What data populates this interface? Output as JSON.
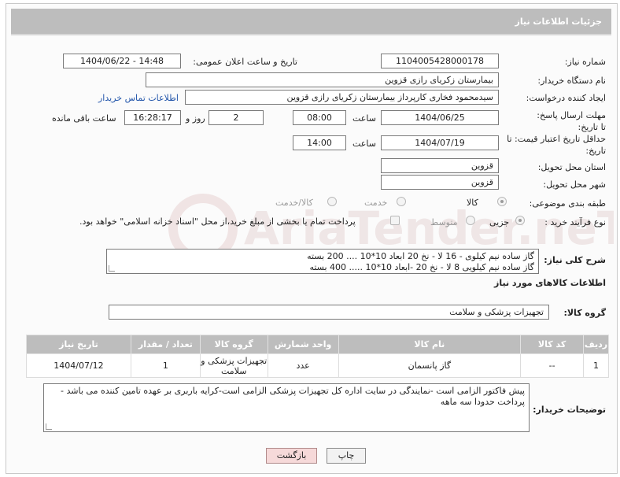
{
  "header": {
    "title": "جزئیات اطلاعات نیاز"
  },
  "labels": {
    "need_number": "شماره نیاز:",
    "announce_datetime": "تاریخ و ساعت اعلان عمومی:",
    "buyer_org": "نام دستگاه خریدار:",
    "requester": "ایجاد کننده درخواست:",
    "buyer_contact": "اطلاعات تماس خریدار",
    "reply_deadline": "مهلت ارسال پاسخ: تا تاریخ:",
    "time": "ساعت",
    "day_and": "روز و",
    "time_remaining": "ساعت باقی مانده",
    "price_validity": "حداقل تاریخ اعتبار قیمت: تا تاریخ:",
    "delivery_province": "استان محل تحویل:",
    "delivery_city": "شهر محل تحویل:",
    "category": "طبقه بندی موضوعی:",
    "process_type": "نوع فرآیند خرید :",
    "description": "شرح کلی نیاز:",
    "goods_info": "اطلاعات کالاهای مورد نیاز",
    "goods_group": "گروه کالا:",
    "buyer_notes": "توضیحات خریدار:"
  },
  "fields": {
    "need_number": "1104005428000178",
    "announce_datetime": "1404/06/22 - 14:48",
    "buyer_org": "بیمارستان زکریای رازی قزوین",
    "requester": "سیدمحمود فخاری کارپرداز بیمارستان زکریای رازی قزوین",
    "reply_date": "1404/06/25",
    "reply_time": "08:00",
    "days_remaining": "2",
    "time_remaining": "16:28:17",
    "validity_date": "1404/07/19",
    "validity_time": "14:00",
    "province": "قزوین",
    "city": "قزوین",
    "goods_group": "تجهیزات پزشکی و سلامت"
  },
  "category_options": [
    {
      "label": "کالا",
      "selected": true
    },
    {
      "label": "خدمت",
      "selected": false
    },
    {
      "label": "کالا/خدمت",
      "selected": false
    }
  ],
  "process_options": [
    {
      "label": "جزیی",
      "selected": true
    },
    {
      "label": "متوسط",
      "selected": false
    }
  ],
  "process_note": "پرداخت تمام یا بخشی از مبلغ خرید،از محل \"اسناد خزانه اسلامی\" خواهد بود.",
  "description_lines": [
    "گاز ساده نیم کیلوی - 16 لا - نخ 20 ابعاد 10*10 .... 200 بسته",
    "گاز ساده نیم کیلویی 8 لا - نخ 20 -ابعاد 10*10 ..... 400 بسته"
  ],
  "table": {
    "headers": [
      "ردیف",
      "کد کالا",
      "نام کالا",
      "واحد شمارش",
      "گروه کالا",
      "تعداد / مقدار",
      "تاریخ نیاز"
    ],
    "rows": [
      [
        "1",
        "--",
        "گاز پانسمان",
        "عدد",
        "تجهیزات پزشکی و سلامت",
        "1",
        "1404/07/12"
      ]
    ]
  },
  "buyer_notes": "پیش فاکتور الزامی است -نمایندگی در سایت اداره کل تجهیزات پزشکی الزامی است-کرایه باربری بر عهده تامین کننده می باشد - پرداخت حدودا سه ماهه",
  "buttons": {
    "print": "چاپ",
    "back": "بازگشت"
  },
  "watermark": {
    "text": "AriaTender.neT"
  },
  "colors": {
    "header_bg": "#bdbdbd",
    "link": "#2255aa",
    "back_button_bg": "#f6d9d9"
  }
}
